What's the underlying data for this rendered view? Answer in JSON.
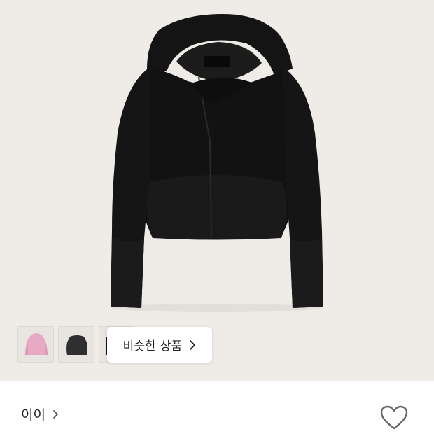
{
  "product": {
    "similar_label": "비슷한 상품",
    "brand_name": "이이",
    "image_background": "#efece7",
    "garment_color": "#111111"
  },
  "thumbnails": [
    {
      "icon": "pink-hoodie-thumbnail",
      "color": "#e7a9c3"
    },
    {
      "icon": "charcoal-top-thumbnail",
      "color": "#2f2f2f"
    },
    {
      "icon": "black-hoodie-thumbnail",
      "color": "#111111"
    }
  ],
  "icons": {
    "similar_chevron": "chevron-right-icon",
    "brand_chevron": "chevron-right-icon",
    "favorite": "heart-outline-icon"
  }
}
